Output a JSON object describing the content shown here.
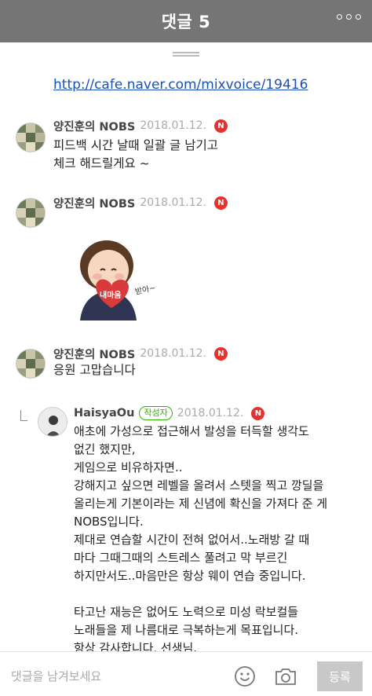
{
  "header": {
    "title": "댓글 5",
    "more_icon": "more-icon"
  },
  "link_text": "http://cafe.naver.com/mixvoice/19416",
  "comments": [
    {
      "author": "양진훈의 NOBS",
      "date": "2018.01.12.",
      "badge": "N",
      "lines": [
        "피드백 시간 날때 일괄 글 남기고",
        "체크 해드릴게요 ~"
      ]
    },
    {
      "author": "양진훈의 NOBS",
      "date": "2018.01.12.",
      "badge": "N",
      "sticker": {
        "heart_text": "내마음",
        "side_text": "받아~"
      }
    },
    {
      "author": "양진훈의 NOBS",
      "date": "2018.01.12.",
      "badge": "N",
      "lines": [
        "응원 고맙습니다"
      ]
    }
  ],
  "reply": {
    "author": "HaisyaOu",
    "writer_badge": "작성자",
    "date": "2018.01.12.",
    "badge": "N",
    "lines": [
      "애초에 가성으로 접근해서 발성을 터득할 생각도",
      "없긴 했지만,",
      "게임으로 비유하자면..",
      "강해지고 싶으면 레벨을 올려서 스텟을 찍고 깡딜을",
      "올리는게 기본이라는 제 신념에 확신을 가져다 준 게",
      "NOBS입니다.",
      "제대로 연습할 시간이 전혀 없어서..노래방 갈 때",
      "마다 그때그때의 스트레스 풀려고 막 부르긴",
      "하지만서도..마음만은 항상 웨이 연습 중입니다.",
      "",
      "타고난 재능은 없어도 노력으로 미성 락보컬들",
      "노래들을 제 나름대로 극복하는게 목표입니다.",
      "항상 감사합니다, 선생님."
    ]
  },
  "input": {
    "placeholder": "댓글을 남겨보세요",
    "submit_label": "등록"
  },
  "colors": {
    "header_bg": "#757575",
    "link": "#1a4fb3",
    "new_badge": "#e5322d",
    "writer_badge": "#2db400",
    "submit_bg": "#c8c8c8"
  }
}
